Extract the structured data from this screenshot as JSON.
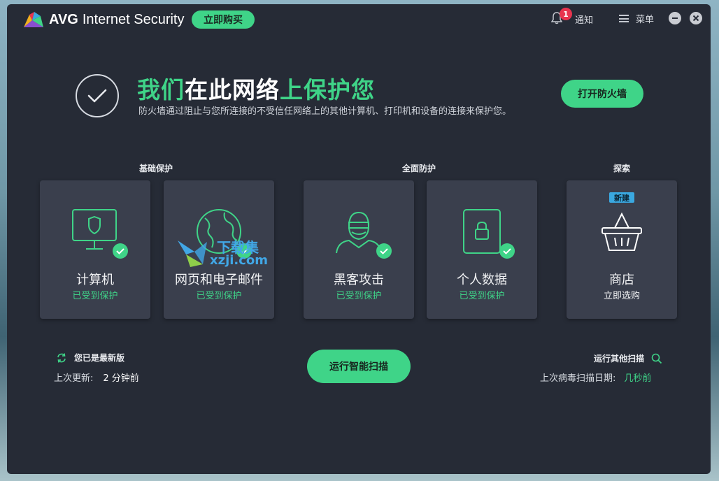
{
  "app": {
    "logo_brand": "AVG",
    "logo_product": "Internet Security",
    "buy_label": "立即购买",
    "notifications_label": "通知",
    "notifications_count": "1",
    "menu_label": "菜单"
  },
  "hero": {
    "title_part1": "我们",
    "title_part2": "在此网络",
    "title_part3": "上保护您",
    "subtitle": "防火墙通过阻止与您所连接的不受信任网络上的其他计算机、打印机和设备的连接来保护您。",
    "firewall_button": "打开防火墙"
  },
  "sections": {
    "basic": "基础保护",
    "full": "全面防护",
    "explore": "探索"
  },
  "cards": [
    {
      "name": "计算机",
      "status": "已受到保护",
      "icon": "monitor-shield-icon"
    },
    {
      "name": "网页和电子邮件",
      "status": "已受到保护",
      "icon": "globe-icon"
    },
    {
      "name": "黑客攻击",
      "status": "已受到保护",
      "icon": "hacker-icon"
    },
    {
      "name": "个人数据",
      "status": "已受到保护",
      "icon": "locked-document-icon"
    },
    {
      "name": "商店",
      "status": "立即选购",
      "icon": "shopping-basket-icon",
      "badge": "新建"
    }
  ],
  "footer": {
    "up_to_date": "您已是最新版",
    "last_update_label": "上次更新:",
    "last_update_value": "2 分钟前",
    "smart_scan_button": "运行智能扫描",
    "other_scans": "运行其他扫描",
    "last_scan_label": "上次病毒扫描日期:",
    "last_scan_value": "几秒前"
  },
  "watermark": {
    "line1": "下载集",
    "line2": "xzji.com"
  },
  "colors": {
    "accent": "#3fd488",
    "background": "#262b36",
    "card": "#3a3f4d",
    "badge_red": "#e8344e",
    "new_badge": "#3aa8e0"
  }
}
